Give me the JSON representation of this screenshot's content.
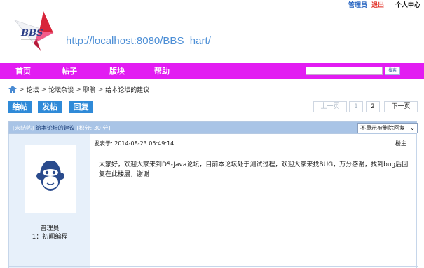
{
  "userbar": {
    "admin": "管理员",
    "logout": "退出",
    "center": "个人中心"
  },
  "site": {
    "url": "http://localhost:8080/BBS_hart/",
    "logo_text": "BBS"
  },
  "nav": {
    "items": [
      "首页",
      "帖子",
      "版块",
      "帮助"
    ],
    "search_placeholder": "",
    "search_button": "搜索"
  },
  "breadcrumb": [
    "论坛",
    "论坛杂谈",
    "聊聊",
    "给本论坛的建议"
  ],
  "actions": {
    "close": "结帖",
    "post": "发帖",
    "reply": "回复"
  },
  "pager": {
    "prev": "上一页",
    "pages": [
      "1",
      "2"
    ],
    "next": "下一页"
  },
  "thread": {
    "status": "[未结帖]",
    "title": "给本论坛的建议",
    "points": "[积分: 30 分]",
    "filter": "不显示被删除回复"
  },
  "post": {
    "author_name": "管理员",
    "author_rank": "1：初闻编程",
    "posted_label": "发表于:",
    "posted_time": "2014-08-23 05:49:14",
    "floor": "楼主",
    "body": "大家好，欢迎大家来到DS-Java论坛，目前本论坛处于测试过程，欢迎大家来找BUG，万分感谢，找到bug后回复在此楼层，谢谢"
  },
  "colors": {
    "nav": "#e21cf2",
    "button": "#2f8ad8",
    "titlebar": "#a9c4e6",
    "author_panel": "#e7f0fa",
    "url": "#4d8fd6",
    "logout": "#e0281e"
  }
}
